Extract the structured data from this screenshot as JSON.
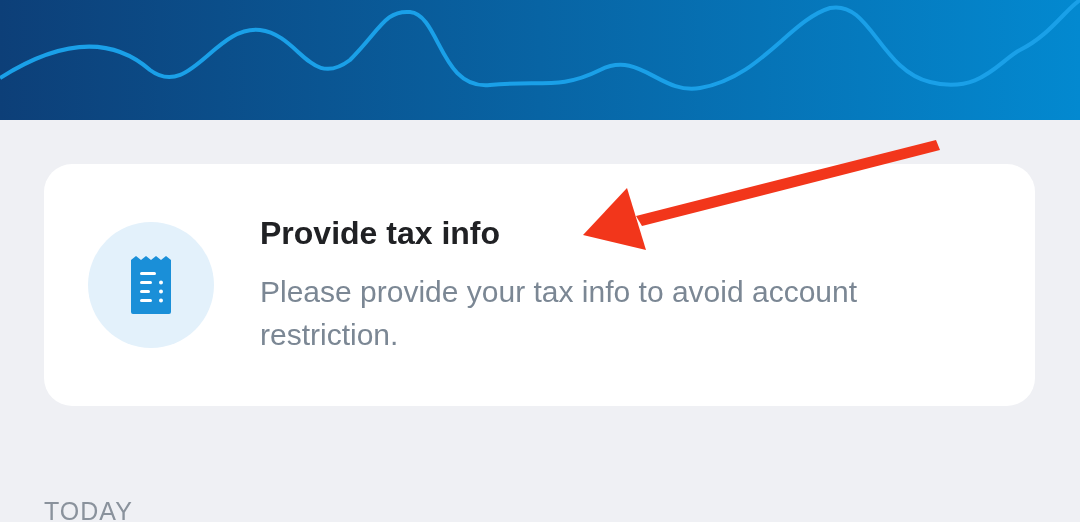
{
  "notice_card": {
    "title": "Provide tax info",
    "description": "Please provide your tax info to avoid account restriction."
  },
  "section_label": "TODAY"
}
